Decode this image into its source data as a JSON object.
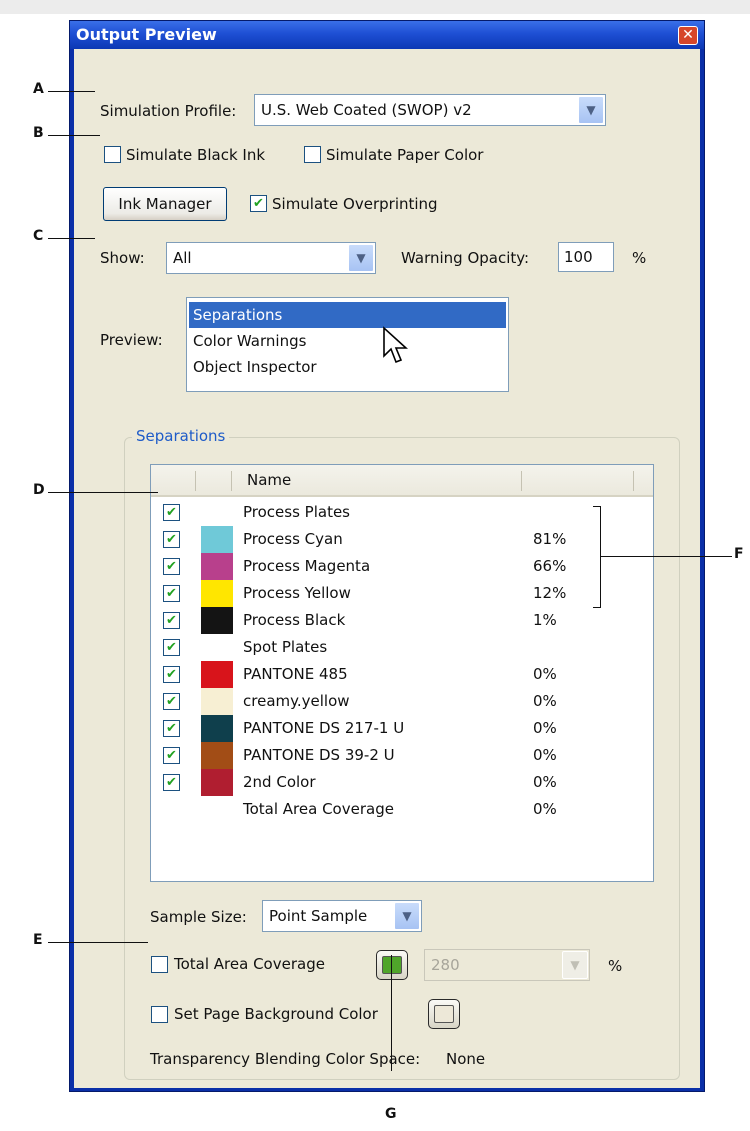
{
  "window": {
    "title": "Output Preview"
  },
  "simulation_profile": {
    "label": "Simulation Profile:",
    "value": "U.S. Web Coated (SWOP) v2"
  },
  "simulate_black_ink": {
    "label": "Simulate Black Ink",
    "checked": false
  },
  "simulate_paper_color": {
    "label": "Simulate Paper Color",
    "checked": false
  },
  "ink_manager": {
    "label": "Ink Manager"
  },
  "simulate_overprinting": {
    "label": "Simulate Overprinting",
    "checked": true
  },
  "show": {
    "label": "Show:",
    "value": "All"
  },
  "warning_opacity": {
    "label": "Warning Opacity:",
    "value": "100",
    "unit": "%"
  },
  "preview": {
    "label": "Preview:",
    "options": [
      "Separations",
      "Color Warnings",
      "Object Inspector"
    ],
    "selected": "Separations"
  },
  "separations": {
    "group_title": "Separations",
    "header_name": "Name",
    "rows": [
      {
        "checked": true,
        "swatch": "",
        "name": "Process Plates",
        "pct": ""
      },
      {
        "checked": true,
        "swatch": "#6fc9d8",
        "name": "Process Cyan",
        "pct": "81%"
      },
      {
        "checked": true,
        "swatch": "#b8408c",
        "name": "Process Magenta",
        "pct": "66%"
      },
      {
        "checked": true,
        "swatch": "#ffe600",
        "name": "Process Yellow",
        "pct": "12%"
      },
      {
        "checked": true,
        "swatch": "#141414",
        "name": "Process Black",
        "pct": "1%"
      },
      {
        "checked": true,
        "swatch": "",
        "name": "Spot Plates",
        "pct": ""
      },
      {
        "checked": true,
        "swatch": "#d8141b",
        "name": "PANTONE 485",
        "pct": "0%"
      },
      {
        "checked": true,
        "swatch": "#f7efd3",
        "name": "creamy.yellow",
        "pct": "0%"
      },
      {
        "checked": true,
        "swatch": "#0f3f4c",
        "name": "PANTONE DS 217-1 U",
        "pct": "0%"
      },
      {
        "checked": true,
        "swatch": "#a24d16",
        "name": "PANTONE DS 39-2 U",
        "pct": "0%"
      },
      {
        "checked": true,
        "swatch": "#b01e30",
        "name": "2nd Color",
        "pct": "0%"
      },
      {
        "checked": false,
        "swatch": "",
        "name": "Total Area Coverage",
        "pct": "0%"
      }
    ]
  },
  "sample_size": {
    "label": "Sample Size:",
    "value": "Point Sample"
  },
  "total_area_coverage": {
    "label": "Total Area Coverage",
    "checked": false,
    "color": "#4fa52a",
    "value": "280",
    "unit": "%"
  },
  "page_background": {
    "label": "Set Page Background Color",
    "checked": false,
    "color": "#ede8d8"
  },
  "transparency": {
    "label": "Transparency Blending Color Space:",
    "value": "None"
  },
  "callouts": {
    "a": "A",
    "b": "B",
    "c": "C",
    "d": "D",
    "e": "E",
    "f": "F",
    "g": "G"
  }
}
